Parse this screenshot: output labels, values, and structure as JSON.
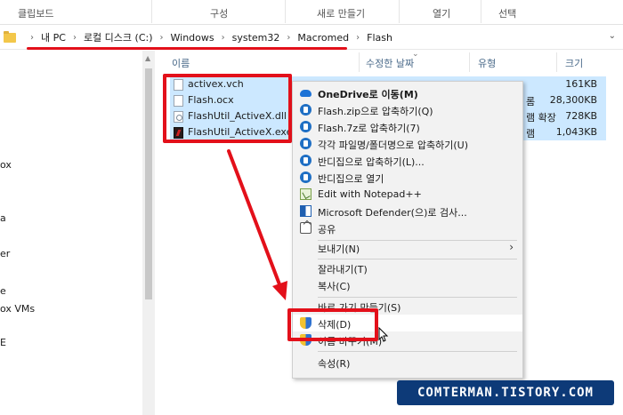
{
  "ribbon": {
    "groups": [
      "클립보드",
      "구성",
      "새로 만들기",
      "열기",
      "선택"
    ]
  },
  "address": {
    "crumbs": [
      "내 PC",
      "로컬 디스크 (C:)",
      "Windows",
      "system32",
      "Macromed",
      "Flash"
    ]
  },
  "nav": {
    "items": [
      "ox",
      "a",
      "er",
      "e",
      "ox VMs",
      "E"
    ]
  },
  "columns": {
    "name": "이름",
    "modified": "수정한 날짜",
    "type": "유형",
    "size": "크기"
  },
  "files": [
    {
      "name": "activex.vch",
      "type": "",
      "size": "161KB",
      "icon": "file-icon"
    },
    {
      "name": "Flash.ocx",
      "type": "롬",
      "size": "28,300KB",
      "icon": "file-icon"
    },
    {
      "name": "FlashUtil_ActiveX.dll",
      "type": "램 확장",
      "size": "728KB",
      "icon": "dll-icon"
    },
    {
      "name": "FlashUtil_ActiveX.exe",
      "type": "램",
      "size": "1,043KB",
      "icon": "flash-exe-icon"
    }
  ],
  "context_menu": {
    "onedrive": "OneDrive로 이동(M)",
    "zip": "Flash.zip으로 압축하기(Q)",
    "seven_z": "Flash.7z로 압축하기(7)",
    "each": "각각 파일명/폴더명으로 압축하기(U)",
    "bandizip_compress": "반디집으로 압축하기(L)...",
    "bandizip_open": "반디집으로 열기",
    "notepad": "Edit with Notepad++",
    "defender": "Microsoft Defender(으)로 검사...",
    "share": "공유",
    "send_to": "보내기(N)",
    "cut": "잘라내기(T)",
    "copy": "복사(C)",
    "shortcut": "바로 가기 만들기(S)",
    "delete": "삭제(D)",
    "rename": "이름 바꾸기(M)",
    "properties": "속성(R)"
  },
  "watermark": "COMTERMAN.TISTORY.COM",
  "colors": {
    "highlight": "#e3101a",
    "selection": "#cce8ff",
    "watermark_bg": "#0d3a78"
  }
}
